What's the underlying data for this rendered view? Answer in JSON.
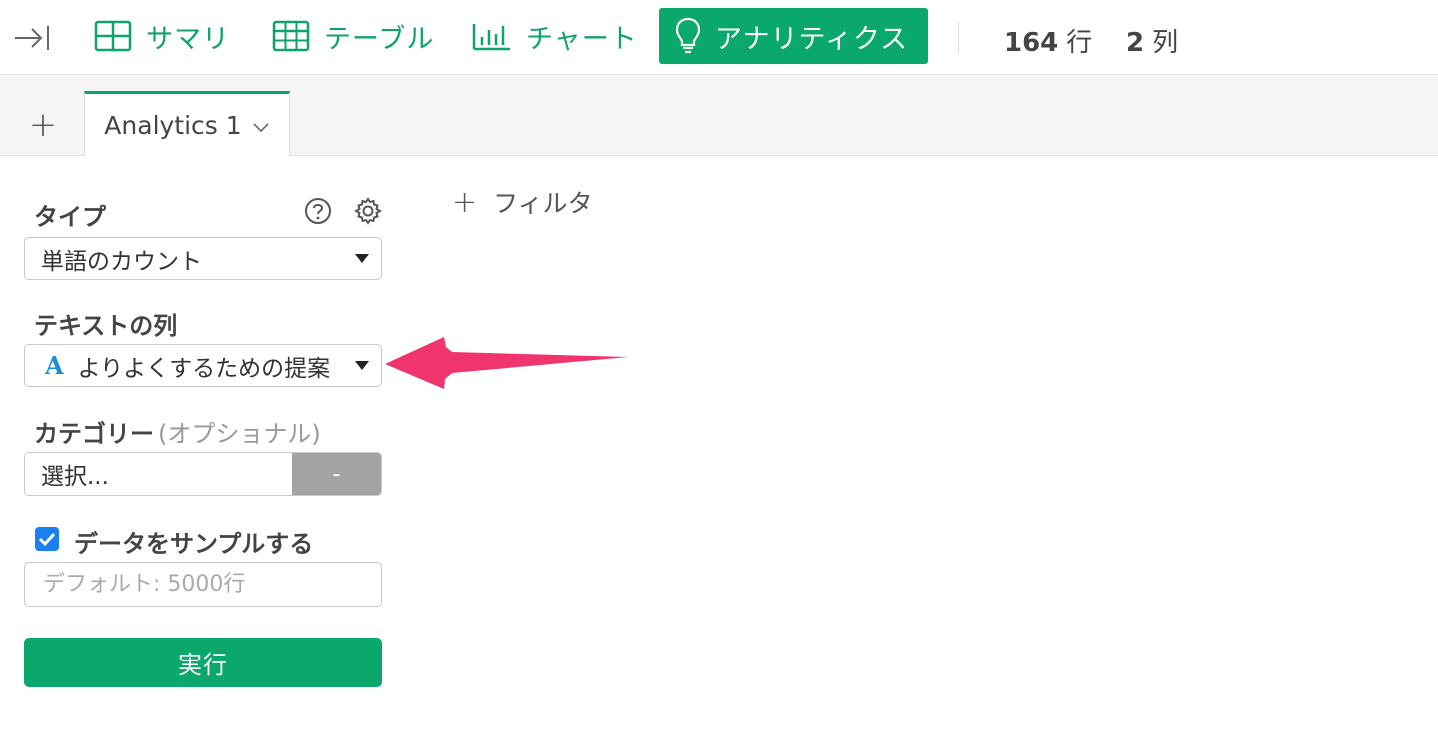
{
  "toolbar": {
    "nav": [
      {
        "label": "サマリ",
        "icon": "summary-grid-icon"
      },
      {
        "label": "テーブル",
        "icon": "table-icon"
      },
      {
        "label": "チャート",
        "icon": "chart-icon"
      },
      {
        "label": "アナリティクス",
        "icon": "lightbulb-icon",
        "active": true
      }
    ],
    "rows_count": "164",
    "rows_unit": "行",
    "cols_count": "2",
    "cols_unit": "列"
  },
  "tabs": {
    "add_label": "+",
    "items": [
      {
        "label": "Analytics 1",
        "active": true
      }
    ]
  },
  "panel": {
    "type_label": "タイプ",
    "type_value": "単語のカウント",
    "text_column_label": "テキストの列",
    "text_column_type_badge": "A",
    "text_column_value": "よりよくするための提案",
    "category_label": "カテゴリー",
    "category_optional": "(オプショナル)",
    "category_value": "選択...",
    "category_clear": "-",
    "sample_label": "データをサンプルする",
    "sample_checked": true,
    "sample_placeholder": "デフォルト: 5000行",
    "run_label": "実行"
  },
  "filter": {
    "plus": "+",
    "label": "フィルタ"
  },
  "colors": {
    "accent": "#0aa86c",
    "accent_text": "#0fa36b",
    "checkbox": "#1a7ff0",
    "annotation_arrow": "#f0346e"
  }
}
